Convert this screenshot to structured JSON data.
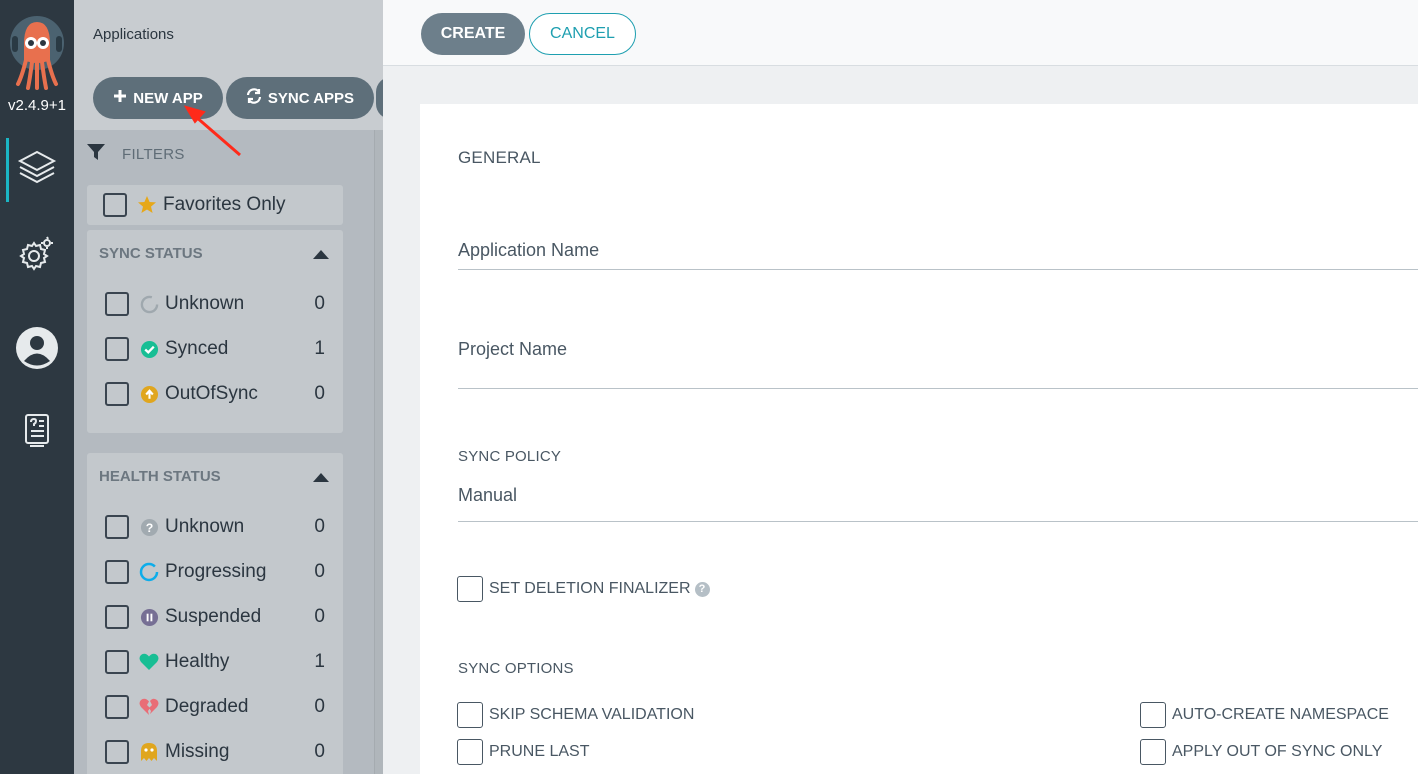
{
  "nav": {
    "version": "v2.4.9+1",
    "items": [
      "layers-icon",
      "settings-icon",
      "user-icon",
      "docs-icon"
    ]
  },
  "apps_panel": {
    "title": "Applications",
    "toolbar": {
      "new_app_label": "NEW APP",
      "sync_apps_label": "SYNC APPS"
    },
    "filters_label": "FILTERS",
    "favorites_label": "Favorites Only",
    "sync_status": {
      "title": "SYNC STATUS",
      "items": [
        {
          "label": "Unknown",
          "count": "0"
        },
        {
          "label": "Synced",
          "count": "1"
        },
        {
          "label": "OutOfSync",
          "count": "0"
        }
      ]
    },
    "health_status": {
      "title": "HEALTH STATUS",
      "items": [
        {
          "label": "Unknown",
          "count": "0"
        },
        {
          "label": "Progressing",
          "count": "0"
        },
        {
          "label": "Suspended",
          "count": "0"
        },
        {
          "label": "Healthy",
          "count": "1"
        },
        {
          "label": "Degraded",
          "count": "0"
        },
        {
          "label": "Missing",
          "count": "0"
        }
      ]
    }
  },
  "panel": {
    "create_label": "CREATE",
    "cancel_label": "CANCEL",
    "general_label": "GENERAL",
    "app_name_label": "Application Name",
    "project_name_label": "Project Name",
    "sync_policy_label": "SYNC POLICY",
    "sync_policy_value": "Manual",
    "deletion_finalizer_label": "SET DELETION FINALIZER",
    "sync_options_label": "SYNC OPTIONS",
    "sync_options": {
      "skip_schema": "SKIP SCHEMA VALIDATION",
      "prune_last": "PRUNE LAST",
      "auto_create_ns": "AUTO-CREATE NAMESPACE",
      "apply_out_of_sync": "APPLY OUT OF SYNC ONLY"
    }
  },
  "colors": {
    "accent": "#1e9fb0",
    "synced": "#18be94",
    "out_of_sync": "#f4c030",
    "healthy": "#18be94",
    "degraded": "#e96d76",
    "suspended": "#766f94",
    "progressing": "#0dadea",
    "annotation_arrow": "#ff2a1a"
  }
}
